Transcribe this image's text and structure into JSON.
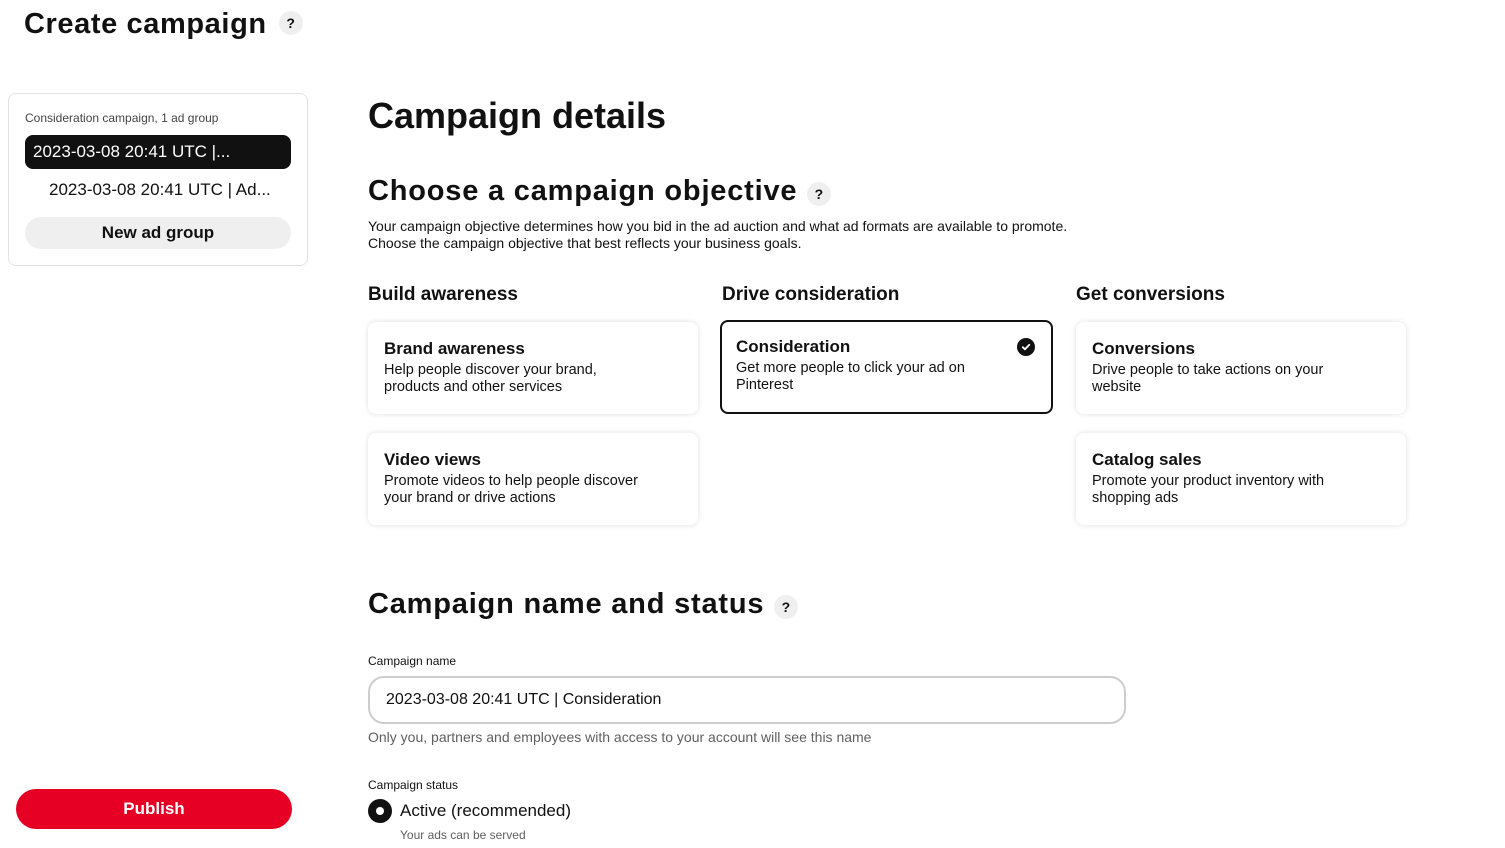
{
  "header": {
    "title": "Create campaign",
    "help_icon": "question-mark-icon",
    "help_glyph": "?"
  },
  "sidebar": {
    "caption": "Consideration campaign, 1 ad group",
    "campaign_item": "2023-03-08 20:41 UTC |...",
    "ad_group_item": "2023-03-08 20:41 UTC | Ad...",
    "new_ad_group_label": "New ad group",
    "publish_label": "Publish"
  },
  "main": {
    "section_title": "Campaign details",
    "objective": {
      "title": "Choose a campaign objective",
      "description_line1": "Your campaign objective determines how you bid in the ad auction and what ad formats are available to promote.",
      "description_line2": "Choose the campaign objective that best reflects your business goals.",
      "columns": [
        {
          "heading": "Build awareness",
          "options": [
            {
              "title": "Brand awareness",
              "description": "Help people discover your brand, products and other services",
              "selected": false
            },
            {
              "title": "Video views",
              "description": "Promote videos to help people discover your brand or drive actions",
              "selected": false
            }
          ]
        },
        {
          "heading": "Drive consideration",
          "options": [
            {
              "title": "Consideration",
              "description": "Get more people to click your ad on Pinterest",
              "selected": true
            }
          ]
        },
        {
          "heading": "Get conversions",
          "options": [
            {
              "title": "Conversions",
              "description": "Drive people to take actions on your website",
              "selected": false
            },
            {
              "title": "Catalog sales",
              "description": "Promote your product inventory with shopping ads",
              "selected": false
            }
          ]
        }
      ]
    },
    "name_status": {
      "title": "Campaign name and status",
      "name_label": "Campaign name",
      "name_value": "2023-03-08 20:41 UTC | Consideration",
      "name_helper": "Only you, partners and employees with access to your account will see this name",
      "status_label": "Campaign status",
      "status_option": "Active (recommended)",
      "status_option_selected": true,
      "status_helper": "Your ads can be served"
    }
  },
  "colors": {
    "accent_red": "#e60023",
    "selected_dark": "#111111",
    "chip_gray": "#efefef"
  }
}
